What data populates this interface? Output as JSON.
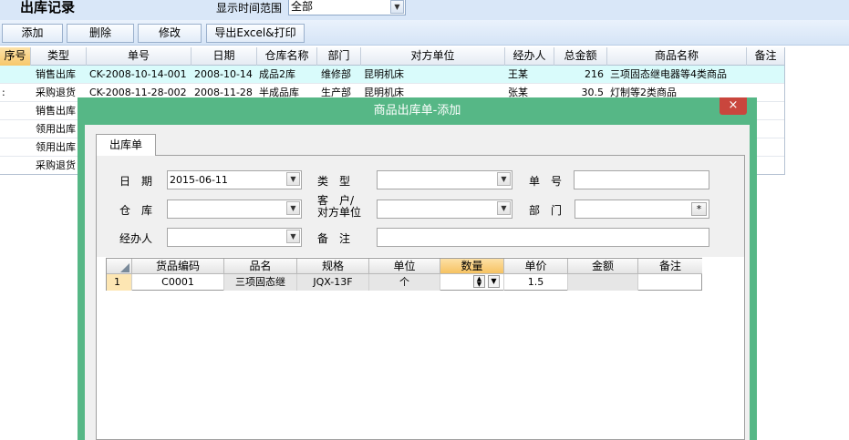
{
  "page": {
    "title": "出库记录",
    "range_label": "显示时间范围",
    "range_value": "全部"
  },
  "toolbar": {
    "add": "添加",
    "delete": "删除",
    "edit": "修改",
    "export": "导出Excel&打印"
  },
  "records": {
    "columns": [
      "序号",
      "类型",
      "单号",
      "日期",
      "仓库名称",
      "部门",
      "对方单位",
      "经办人",
      "总金额",
      "商品名称",
      "备注"
    ],
    "rows": [
      {
        "idx": "",
        "type": "销售出库",
        "no": "CK-2008-10-14-001",
        "date": "2008-10-14",
        "store": "成品2库",
        "dept": "维修部",
        "party": "昆明机床",
        "handler": "王某",
        "total": "216",
        "goods": "三项固态继电器等4类商品",
        "note": ""
      },
      {
        "idx": ":",
        "type": "采购退货",
        "no": "CK-2008-11-28-002",
        "date": "2008-11-28",
        "store": "半成品库",
        "dept": "生产部",
        "party": "昆明机床",
        "handler": "张某",
        "total": "30.5",
        "goods": "灯制等2类商品",
        "note": ""
      },
      {
        "idx": "",
        "type": "销售出库",
        "no": "",
        "date": "",
        "store": "",
        "dept": "",
        "party": "",
        "handler": "",
        "total": "",
        "goods": "",
        "note": ""
      },
      {
        "idx": "",
        "type": "领用出库",
        "no": "",
        "date": "",
        "store": "",
        "dept": "",
        "party": "",
        "handler": "",
        "total": "",
        "goods": "",
        "note": ""
      },
      {
        "idx": "",
        "type": "领用出库",
        "no": "",
        "date": "",
        "store": "",
        "dept": "",
        "party": "",
        "handler": "",
        "total": "",
        "goods": "",
        "note": ""
      },
      {
        "idx": "",
        "type": "采购退货",
        "no": "",
        "date": "",
        "store": "",
        "dept": "",
        "party": "",
        "handler": "",
        "total": "",
        "goods": "",
        "note": ""
      }
    ]
  },
  "dialog": {
    "title": "商品出库单-添加",
    "close": "×",
    "tab": "出库单",
    "labels": {
      "date": "日　期",
      "type": "类　型",
      "number": "单　号",
      "store": "仓　库",
      "customer_line1": "客　户/",
      "customer_line2": "对方单位",
      "dept": "部　门",
      "handler": "经办人",
      "note": "备　注"
    },
    "values": {
      "date": "2015-06-11",
      "type": "",
      "number": "",
      "store": "",
      "customer": "",
      "dept": "",
      "handler": "",
      "note": ""
    },
    "dept_button": "*",
    "items": {
      "columns": [
        "货品编码",
        "品名",
        "规格",
        "单位",
        "数量",
        "单价",
        "金额",
        "备注"
      ],
      "rows": [
        {
          "row": "1",
          "code": "C0001",
          "name": "三项固态继",
          "spec": "JQX-13F",
          "unit": "个",
          "qty": "",
          "price": "1.5",
          "amount": "",
          "note": ""
        }
      ]
    }
  },
  "colors": {
    "dialog_frame": "#56b786",
    "selected_header": "#f7c76a",
    "highlight_row": "#d9fbfb",
    "close_button": "#c9463d"
  }
}
